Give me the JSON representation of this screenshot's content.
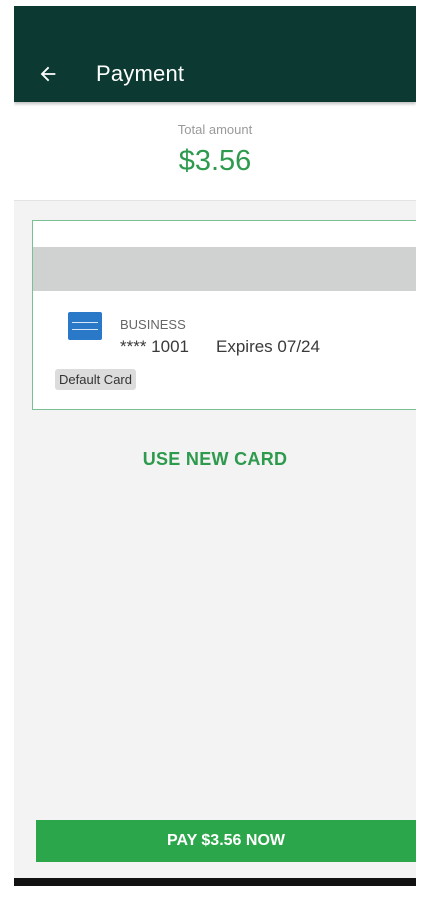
{
  "app_bar": {
    "title": "Payment",
    "back_icon": "arrow-left-icon"
  },
  "total": {
    "label": "Total amount",
    "amount": "$3.56"
  },
  "saved_card": {
    "brand_icon": "amex-card-icon",
    "type": "BUSINESS",
    "masked_number": "**** 1001",
    "expiry": "Expires 07/24",
    "badge": "Default Card"
  },
  "actions": {
    "use_new_card": "USE NEW CARD",
    "pay_button": "PAY $3.56 NOW"
  },
  "colors": {
    "header": "#0c3a32",
    "accent_green": "#2e9a4e",
    "pay_button": "#2ba64a",
    "card_border": "#7bbf95"
  }
}
